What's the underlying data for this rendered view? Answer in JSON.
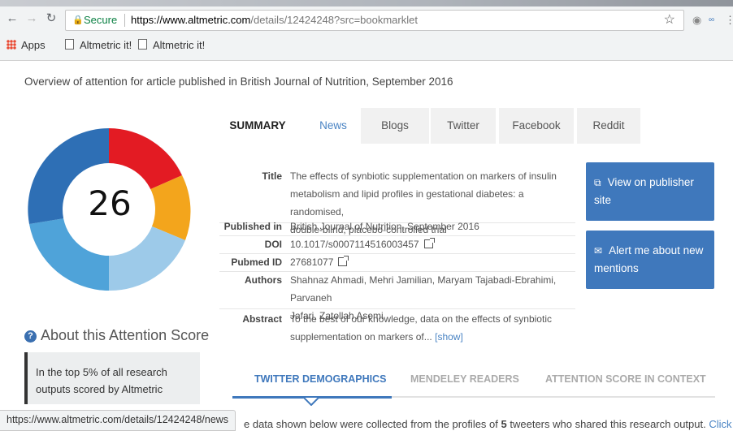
{
  "browser": {
    "secure_label": "Secure",
    "url_host": "https://www.altmetric.com",
    "url_path": "/details/12424248?src=bookmarklet",
    "bookmarks": [
      "Apps",
      "Altmetric it!",
      "Altmetric it!"
    ]
  },
  "page": {
    "title_fragment": "randomised, double-blind, placebo-controlled trial",
    "overview": "Overview of attention for article published in British Journal of Nutrition, September 2016"
  },
  "score": {
    "value": "26",
    "donut_colors": [
      "#e31b23",
      "#f3a51c",
      "#2e6fb5",
      "#4fa3d9",
      "#9dcae9"
    ]
  },
  "about": {
    "heading": "About this Attention Score",
    "percentile": "In the top 5% of all research outputs scored by Altmetric"
  },
  "tabs": [
    "SUMMARY",
    "News",
    "Blogs",
    "Twitter",
    "Facebook",
    "Reddit"
  ],
  "details": {
    "title_label": "Title",
    "title_line1": "The effects of synbiotic supplementation on markers of insulin",
    "title_line2": "metabolism and lipid profiles in gestational diabetes: a randomised,",
    "title_line3": "double-blind, placebo-controlled trial",
    "published_label": "Published in",
    "published": "British Journal of Nutrition, September 2016",
    "doi_label": "DOI",
    "doi": "10.1017/s0007114516003457",
    "pubmed_label": "Pubmed ID",
    "pubmed": "27681077",
    "authors_label": "Authors",
    "authors_line1": "Shahnaz Ahmadi, Mehri Jamilian, Maryam Tajabadi-Ebrahimi, Parvaneh",
    "authors_line2": "Jafari, Zatollah Asemi",
    "abstract_label": "Abstract",
    "abstract_line1": "To the best of our knowledge, data on the effects of synbiotic",
    "abstract_line2": "supplementation on markers of...",
    "show_label": "[show]"
  },
  "actions": {
    "view_publisher": "View on publisher site",
    "alert": "Alert me about new mentions"
  },
  "subtabs": [
    "TWITTER DEMOGRAPHICS",
    "MENDELEY READERS",
    "ATTENTION SCORE IN CONTEXT"
  ],
  "bottom": {
    "text_a": "e data shown below were collected from the profiles of",
    "count": "5",
    "text_b": "tweeters who shared this research output.",
    "link": "Click"
  },
  "status_url": "https://www.altmetric.com/details/12424248/news"
}
